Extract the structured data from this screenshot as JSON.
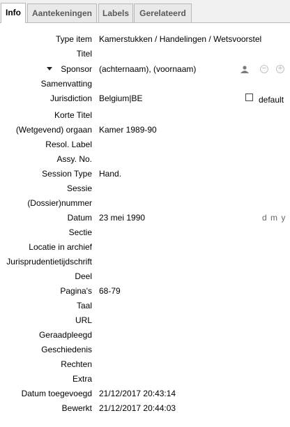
{
  "tabs": [
    {
      "label": "Info",
      "active": true
    },
    {
      "label": "Aantekeningen",
      "active": false
    },
    {
      "label": "Labels",
      "active": false
    },
    {
      "label": "Gerelateerd",
      "active": false
    }
  ],
  "fields": {
    "item_type": {
      "label": "Type item",
      "value": "Kamerstukken / Handelingen / Wetsvoorstel"
    },
    "title": {
      "label": "Titel",
      "value": ""
    },
    "sponsor": {
      "label": "Sponsor",
      "last_name_placeholder": "(achternaam),",
      "first_name_placeholder": "(voornaam)"
    },
    "abstract": {
      "label": "Samenvatting",
      "value": ""
    },
    "jurisdiction": {
      "label": "Jurisdiction",
      "value": "Belgium|BE",
      "default_checkbox_label": "default"
    },
    "short_title": {
      "label": "Korte Titel",
      "value": ""
    },
    "legislative_body": {
      "label": "(Wetgevend) orgaan",
      "value": "Kamer 1989-90"
    },
    "resol_label": {
      "label": "Resol. Label",
      "value": ""
    },
    "assy_no": {
      "label": "Assy. No.",
      "value": ""
    },
    "session_type": {
      "label": "Session Type",
      "value": "Hand."
    },
    "session": {
      "label": "Sessie",
      "value": ""
    },
    "docket_number": {
      "label": "(Dossier)nummer",
      "value": ""
    },
    "date": {
      "label": "Datum",
      "value": "23 mei 1990",
      "format_hint": "d m y"
    },
    "section": {
      "label": "Sectie",
      "value": ""
    },
    "archive_location": {
      "label": "Locatie in archief",
      "value": ""
    },
    "jurisprudence_journal": {
      "label": "Jurisprudentietijdschrift",
      "value": ""
    },
    "volume": {
      "label": "Deel",
      "value": ""
    },
    "pages": {
      "label": "Pagina's",
      "value": "68-79"
    },
    "language": {
      "label": "Taal",
      "value": ""
    },
    "url": {
      "label": "URL",
      "value": ""
    },
    "accessed": {
      "label": "Geraadpleegd",
      "value": ""
    },
    "history": {
      "label": "Geschiedenis",
      "value": ""
    },
    "rights": {
      "label": "Rechten",
      "value": ""
    },
    "extra": {
      "label": "Extra",
      "value": ""
    },
    "date_added": {
      "label": "Datum toegevoegd",
      "value": "21/12/2017 20:43:14"
    },
    "modified": {
      "label": "Bewerkt",
      "value": "21/12/2017 20:44:03"
    }
  },
  "icons": {
    "twisty": "triangle-down-icon",
    "person": "person-icon",
    "remove": "minus-circle-icon",
    "add": "plus-circle-icon"
  }
}
